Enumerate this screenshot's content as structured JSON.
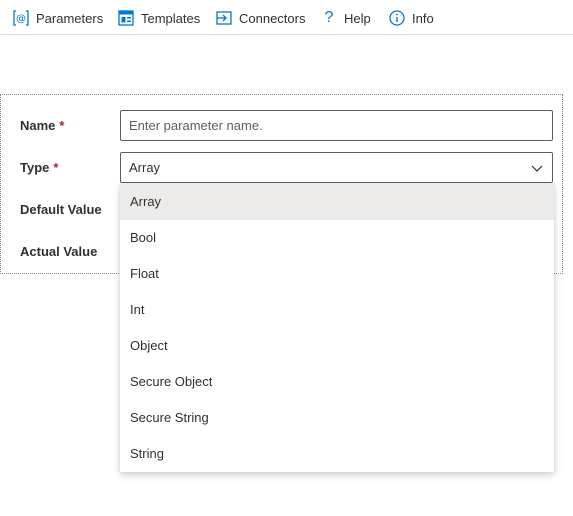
{
  "toolbar": {
    "parameters": "Parameters",
    "templates": "Templates",
    "connectors": "Connectors",
    "help": "Help",
    "info": "Info"
  },
  "form": {
    "name_label": "Name",
    "type_label": "Type",
    "default_label": "Default Value",
    "actual_label": "Actual Value",
    "required_mark": "*",
    "name_placeholder": "Enter parameter name.",
    "type_value": "Array"
  },
  "dropdown": {
    "options": [
      "Array",
      "Bool",
      "Float",
      "Int",
      "Object",
      "Secure Object",
      "Secure String",
      "String"
    ],
    "selected_index": 0
  },
  "colors": {
    "accent": "#0078d4",
    "required": "#a4262c",
    "selected_bg": "#edebe9"
  }
}
